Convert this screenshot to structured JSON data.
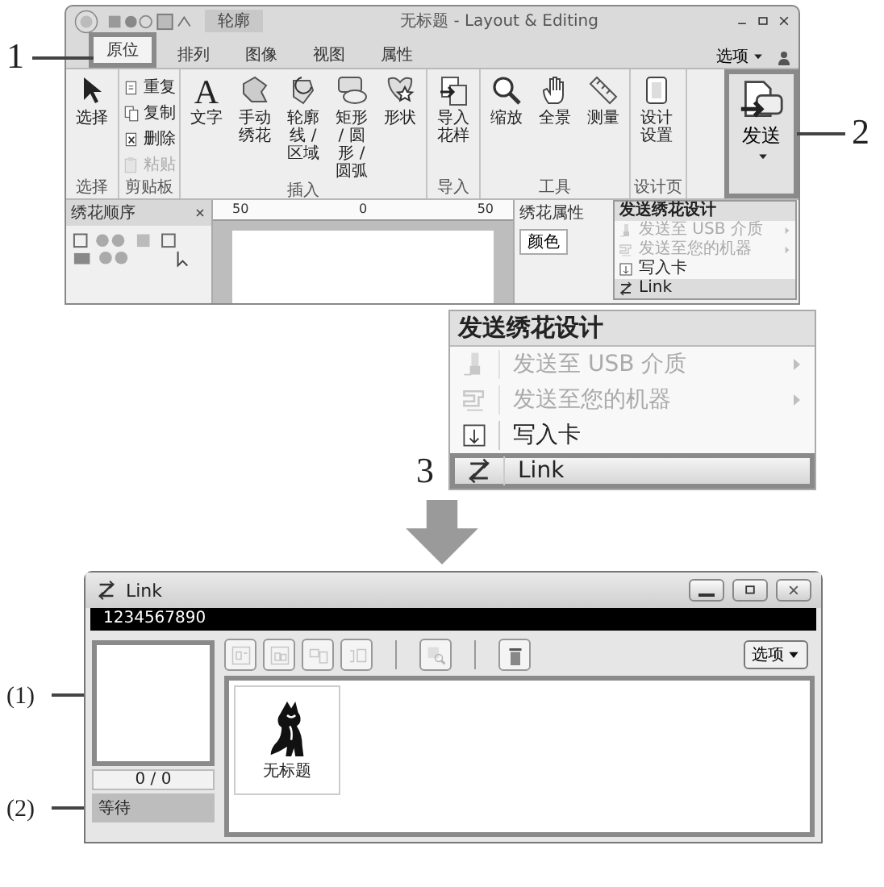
{
  "top_screen": {
    "callouts": [
      {
        "label": "1"
      },
      {
        "label": "2"
      }
    ],
    "context_tab": "轮廓",
    "title": "无标题 - Layout & Editing",
    "tabs": [
      {
        "label": "原位",
        "selected": true,
        "framed": true
      },
      {
        "label": "排列",
        "selected": false,
        "framed": false
      },
      {
        "label": "图像",
        "selected": false,
        "framed": false
      },
      {
        "label": "视图",
        "selected": false,
        "framed": false
      },
      {
        "label": "属性",
        "selected": false,
        "framed": false
      }
    ],
    "options_menu": "选项",
    "groups": [
      {
        "label": "选择",
        "kind": "large",
        "buttons": [
          {
            "label": "选择",
            "kind": "pointer",
            "disabled": false
          }
        ]
      },
      {
        "label": "剪贴板",
        "kind": "small",
        "buttons": [
          {
            "label": "重复",
            "kind": "repeat",
            "disabled": false
          },
          {
            "label": "复制",
            "kind": "copy",
            "disabled": false
          },
          {
            "label": "删除",
            "kind": "delete",
            "disabled": false
          },
          {
            "label": "粘贴",
            "kind": "paste",
            "disabled": true
          }
        ]
      },
      {
        "label": "插入",
        "kind": "large",
        "buttons": [
          {
            "label": "文字",
            "glyph": "A",
            "disabled": false
          },
          {
            "label": "手动绣花",
            "kind": "stitch",
            "disabled": false
          },
          {
            "label": "轮廓线 / 区域",
            "kind": "outline",
            "disabled": false
          },
          {
            "label": "矩形 / 圆形 / 圆弧",
            "kind": "shapes",
            "disabled": false
          },
          {
            "label": "形状",
            "kind": "star",
            "disabled": false
          }
        ]
      },
      {
        "label": "导入",
        "kind": "large",
        "buttons": [
          {
            "label": "导入花样",
            "kind": "import",
            "disabled": false
          }
        ]
      },
      {
        "label": "工具",
        "kind": "large",
        "buttons": [
          {
            "label": "缩放",
            "kind": "zoom",
            "disabled": false
          },
          {
            "label": "全景",
            "kind": "hand",
            "disabled": false
          },
          {
            "label": "测量",
            "kind": "ruler",
            "disabled": false
          }
        ]
      },
      {
        "label": "设计页",
        "kind": "large",
        "buttons": [
          {
            "label": "设计设置",
            "kind": "settings",
            "disabled": false
          }
        ]
      }
    ],
    "send_button": {
      "label": "发送",
      "framed": true
    },
    "left_panel": {
      "title": "绣花顺序"
    },
    "ruler_labels": [
      "50",
      "0",
      "50"
    ],
    "right_panel": {
      "title": "绣花属性",
      "tab": "颜色"
    },
    "dropdown": {
      "title": "发送绣花设计",
      "items": [
        {
          "label": "发送至 USB 介质",
          "kind": "usb",
          "disabled": true,
          "submenu": true,
          "highlighted": false
        },
        {
          "label": "发送至您的机器",
          "kind": "machine",
          "disabled": true,
          "submenu": true,
          "highlighted": false
        },
        {
          "label": "写入卡",
          "kind": "card",
          "disabled": false,
          "submenu": false,
          "highlighted": false
        },
        {
          "label": "Link",
          "kind": "link",
          "disabled": false,
          "submenu": false,
          "highlighted": true
        }
      ]
    }
  },
  "menu_zoom": {
    "callout": "3",
    "title": "发送绣花设计",
    "items": [
      {
        "label": "发送至 USB 介质",
        "kind": "usb",
        "disabled": true,
        "submenu": true,
        "framed": false
      },
      {
        "label": "发送至您的机器",
        "kind": "machine",
        "disabled": true,
        "submenu": true,
        "framed": false
      },
      {
        "label": "写入卡",
        "kind": "card",
        "disabled": false,
        "submenu": false,
        "framed": false
      },
      {
        "label": "Link",
        "kind": "link",
        "disabled": false,
        "submenu": false,
        "framed": true
      }
    ]
  },
  "link_window": {
    "title": "Link",
    "id_bar": "1234567890",
    "toolbar_groups": [
      [
        {
          "kind": "tb-a",
          "disabled": true
        },
        {
          "kind": "tb-b",
          "disabled": true
        },
        {
          "kind": "tb-c",
          "disabled": true
        },
        {
          "kind": "tb-d",
          "disabled": true
        }
      ],
      [
        {
          "kind": "tb-find",
          "disabled": true
        }
      ],
      [
        {
          "kind": "tb-trash",
          "disabled": false
        }
      ]
    ],
    "options_button": "选项",
    "preview_callout": "(1)",
    "list_callout": "(2)",
    "counter": "0 / 0",
    "status": "等待",
    "items": [
      {
        "label": "无标题"
      }
    ]
  }
}
